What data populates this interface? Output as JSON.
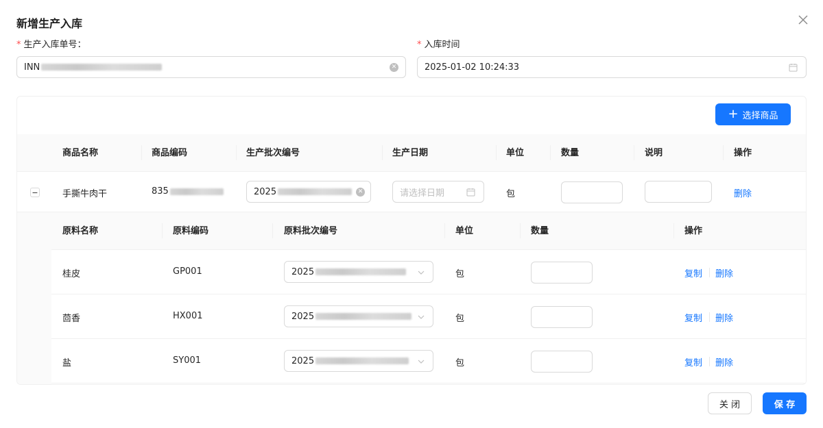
{
  "modal": {
    "title": "新增生产入库"
  },
  "form": {
    "order_no_label": "生产入库单号：",
    "order_no_value": "INN",
    "time_label": "入库时间",
    "time_value": "2025-01-02 10:24:33"
  },
  "toolbar": {
    "select_goods_label": "选择商品"
  },
  "table": {
    "headers": [
      "商品名称",
      "商品编码",
      "生产批次编号",
      "生产日期",
      "单位",
      "数量",
      "说明",
      "操作"
    ],
    "row": {
      "name": "手撕牛肉干",
      "code": "835",
      "batch": "2025",
      "date_placeholder": "请选择日期",
      "unit": "包",
      "delete": "删除"
    }
  },
  "materials": {
    "headers": [
      "原料名称",
      "原料编码",
      "原料批次编号",
      "单位",
      "数量",
      "操作"
    ],
    "rows": [
      {
        "name": "桂皮",
        "code": "GP001",
        "batch": "2025",
        "unit": "包",
        "copy": "复制",
        "delete": "删除"
      },
      {
        "name": "茴香",
        "code": "HX001",
        "batch": "2025",
        "unit": "包",
        "copy": "复制",
        "delete": "删除"
      },
      {
        "name": "盐",
        "code": "SY001",
        "batch": "2025",
        "unit": "包",
        "copy": "复制",
        "delete": "删除"
      }
    ]
  },
  "footer": {
    "close_label": "关 闭",
    "save_label": "保 存"
  },
  "colors": {
    "primary": "#1677ff",
    "required": "#ff4d4f",
    "border": "#d9d9d9"
  }
}
